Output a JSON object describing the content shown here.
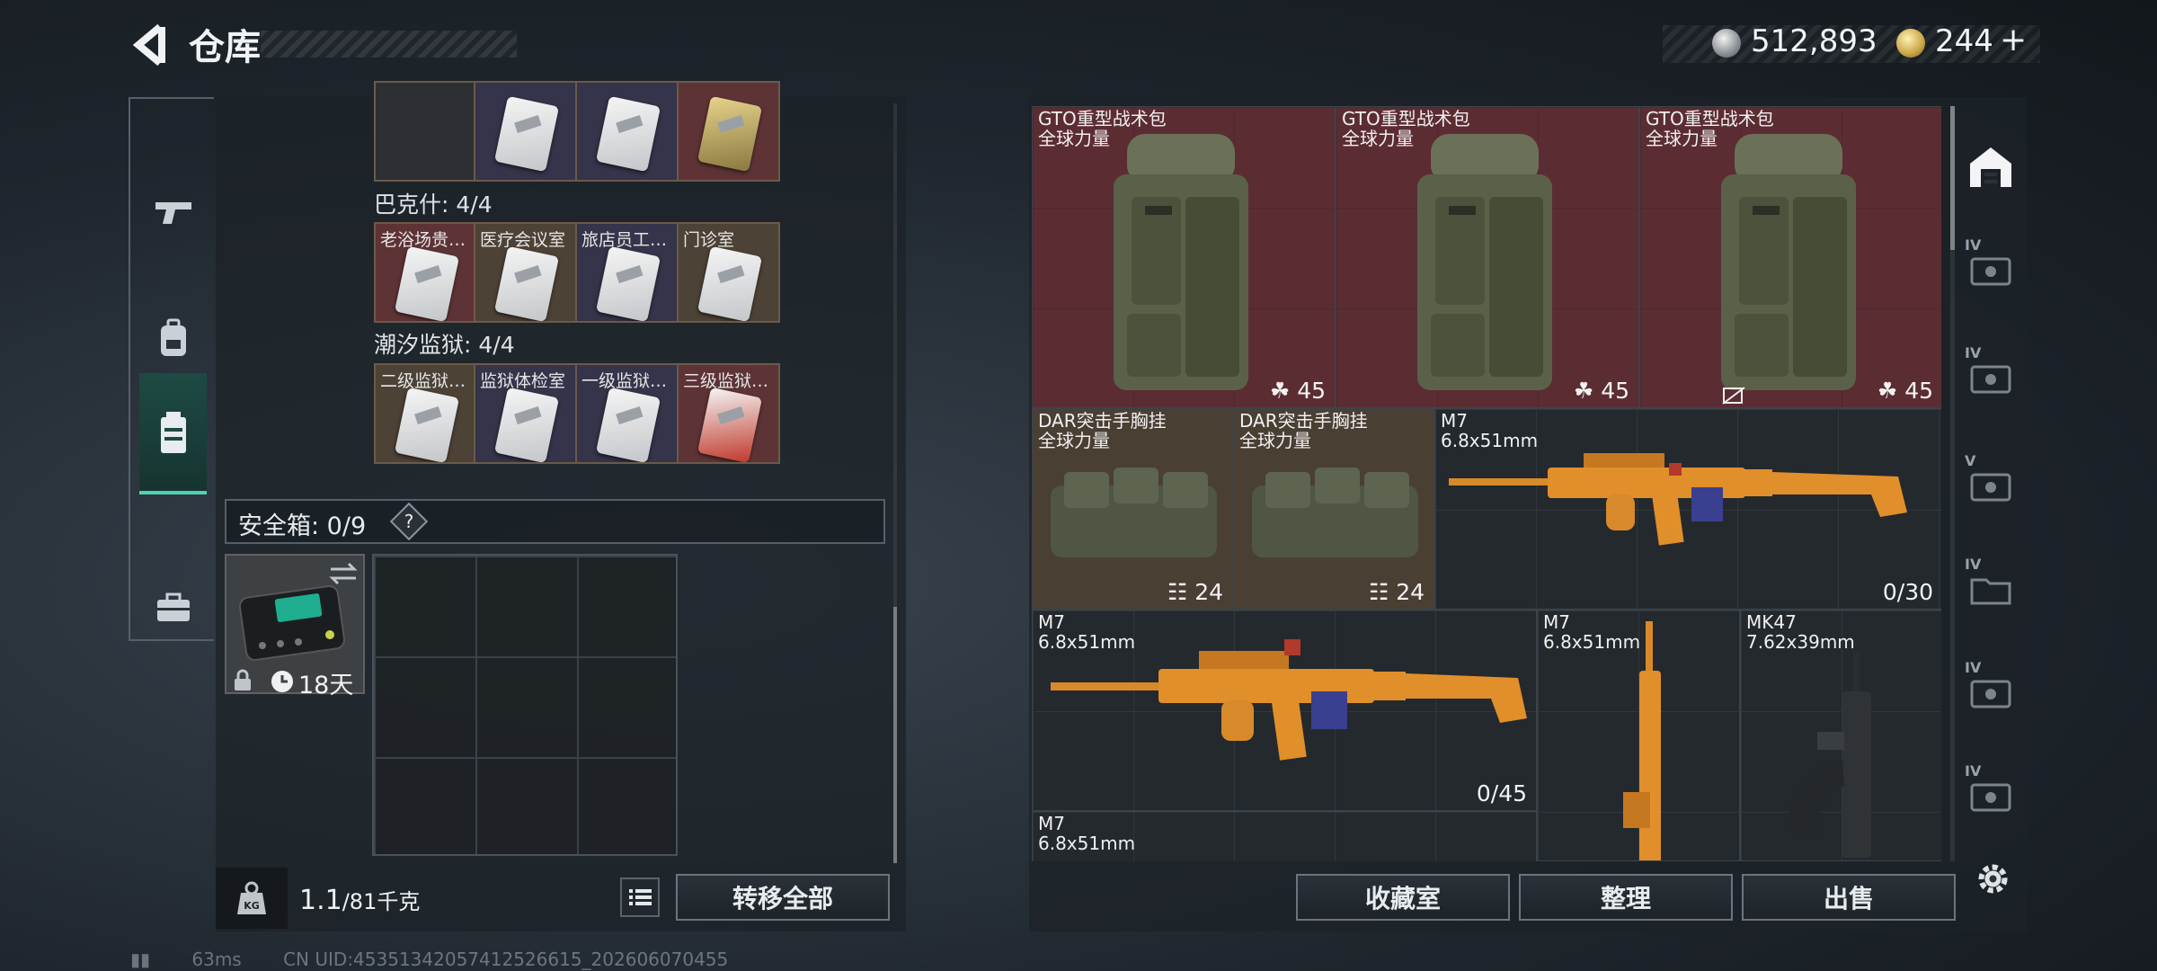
{
  "header": {
    "title": "仓库",
    "silver": "512,893",
    "gold": "244",
    "gold_plus": "+"
  },
  "left_nav": {
    "items": [
      {
        "name": "weapons",
        "icon": "gun-icon"
      },
      {
        "name": "gear",
        "icon": "backpack-icon"
      },
      {
        "name": "containers",
        "icon": "container-icon",
        "active": true
      },
      {
        "name": "items",
        "icon": "toolbox-icon"
      }
    ]
  },
  "keycard_sections": [
    {
      "label": "",
      "cards": [
        {
          "label": "",
          "bg": "dark"
        },
        {
          "label": "",
          "bg": "navy"
        },
        {
          "label": "",
          "bg": "navy"
        },
        {
          "label": "",
          "bg": "red"
        }
      ]
    },
    {
      "label": "巴克什: 4/4",
      "cards": [
        {
          "label": "老浴场贵…",
          "bg": "red"
        },
        {
          "label": "医疗会议室",
          "bg": "brown"
        },
        {
          "label": "旅店员工…",
          "bg": "navy"
        },
        {
          "label": "门诊室",
          "bg": "brown"
        }
      ]
    },
    {
      "label": "潮汐监狱: 4/4",
      "cards": [
        {
          "label": "二级监狱…",
          "bg": "brown"
        },
        {
          "label": "监狱体检室",
          "bg": "navy"
        },
        {
          "label": "一级监狱…",
          "bg": "navy"
        },
        {
          "label": "三级监狱…",
          "bg": "red"
        }
      ]
    }
  ],
  "safebox": {
    "label": "安全箱: 0/9",
    "help": "?",
    "duration": "18天"
  },
  "weight": {
    "current": "1.1",
    "max": "/81千克"
  },
  "left_footer": {
    "transfer_all": "转移全部"
  },
  "inventory": {
    "backpacks": [
      {
        "name": "GTO重型战术包",
        "sub": "全球力量",
        "count": "45"
      },
      {
        "name": "GTO重型战术包",
        "sub": "全球力量",
        "count": "45"
      },
      {
        "name": "GTO重型战术包",
        "sub": "全球力量",
        "count": "45"
      }
    ],
    "vests": [
      {
        "name": "DAR突击手胸挂",
        "sub": "全球力量",
        "count": "24"
      },
      {
        "name": "DAR突击手胸挂",
        "sub": "全球力量",
        "count": "24"
      }
    ],
    "rifles": [
      {
        "name": "M7",
        "sub": "6.8x51mm",
        "ammo": "0/30"
      },
      {
        "name": "M7",
        "sub": "6.8x51mm",
        "ammo": "0/45"
      },
      {
        "name": "M7",
        "sub": "6.8x51mm",
        "ammo": ""
      },
      {
        "name": "MK47",
        "sub": "7.62x39mm",
        "ammo": ""
      },
      {
        "name": "M7",
        "sub": "6.8x51mm",
        "ammo": ""
      }
    ]
  },
  "right_tabs": [
    "IV",
    "IV",
    "V",
    "IV",
    "IV",
    "IV"
  ],
  "bottom_buttons": {
    "collection": "收藏室",
    "organize": "整理",
    "sell": "出售"
  },
  "statusbar": {
    "ping": "63ms",
    "uid": "CN UID:4535134205741252661​5_202606070455"
  },
  "colors": {
    "accent": "#4fd1b5",
    "red_cell": "#5b2d33",
    "tan_cell": "#4a3f33"
  }
}
